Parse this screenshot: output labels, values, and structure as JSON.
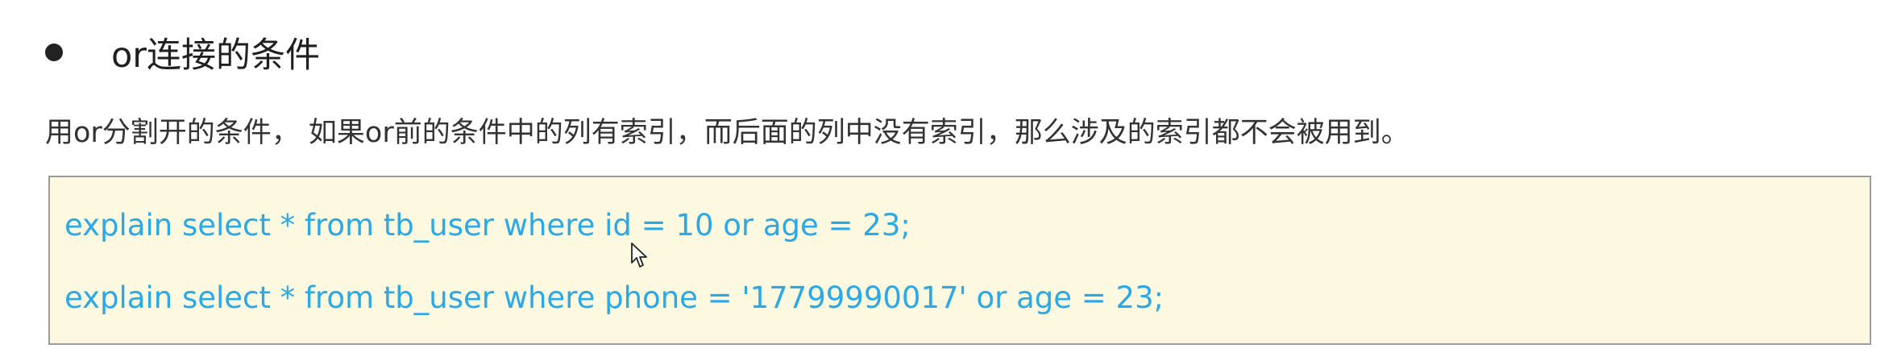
{
  "section": {
    "bullet_icon": "filled-circle-bullet",
    "title": "or连接的条件",
    "description": "用or分割开的条件， 如果or前的条件中的列有索引，而后面的列中没有索引，那么涉及的索引都不会被用到。"
  },
  "code_block": {
    "lines": [
      "explain select * from tb_user where id = 10 or age = 23;",
      "explain select * from tb_user where phone = '17799990017' or age = 23;"
    ],
    "text_color": "#2aa8e8",
    "background_color": "#fdf9e1"
  },
  "cursor_icon": "mouse-pointer-icon"
}
